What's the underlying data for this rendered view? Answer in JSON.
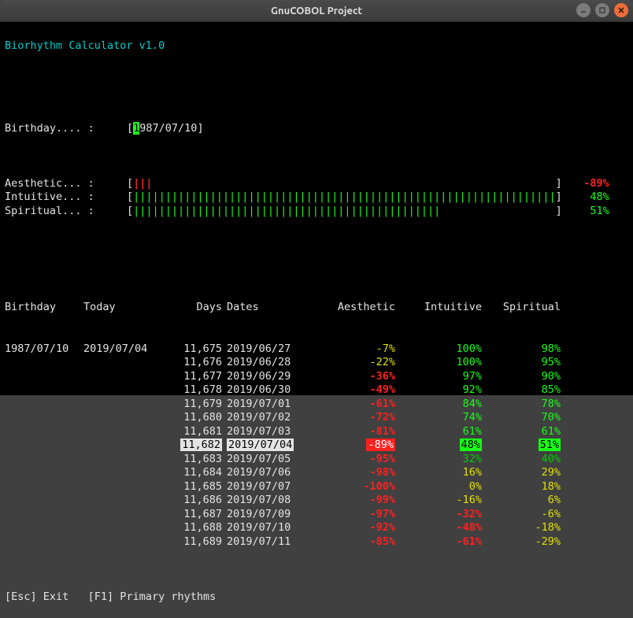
{
  "window": {
    "title": "GnuCOBOL Project"
  },
  "app_title": "Biorhythm Calculator v1.0",
  "input": {
    "label": "Birthday.... : ",
    "open": "[",
    "cursor_char": "1",
    "rest": "987/07/10",
    "close": "]",
    "full_value": "1987/07/10"
  },
  "bars": [
    {
      "label": "Aesthetic... : ",
      "color": "bred",
      "filled": 3,
      "total": 66,
      "pct": "-89%",
      "pct_color": "bred"
    },
    {
      "label": "Intuitive... : ",
      "color": "bgreen",
      "filled": 66,
      "total": 66,
      "pct": "48%",
      "pct_color": "bgreen"
    },
    {
      "label": "Spiritual... : ",
      "color": "bgreen",
      "filled": 48,
      "total": 66,
      "pct": "51%",
      "pct_color": "bgreen"
    }
  ],
  "headers": {
    "birthday": "Birthday",
    "today": "Today",
    "days": "Days",
    "dates": "Dates",
    "aesthetic": "Aesthetic",
    "intuitive": "Intuitive",
    "spiritual": "Spiritual"
  },
  "fixed": {
    "birthday": "1987/07/10",
    "today": "2019/07/04"
  },
  "rows": [
    {
      "days": "11,675",
      "date": "2019/06/27",
      "a": {
        "v": "-7%",
        "c": "yellow"
      },
      "i": {
        "v": "100%",
        "c": "bgreen"
      },
      "s": {
        "v": "98%",
        "c": "bgreen"
      },
      "hl": false
    },
    {
      "days": "11,676",
      "date": "2019/06/28",
      "a": {
        "v": "-22%",
        "c": "yellow"
      },
      "i": {
        "v": "100%",
        "c": "bgreen"
      },
      "s": {
        "v": "95%",
        "c": "bgreen"
      },
      "hl": false
    },
    {
      "days": "11,677",
      "date": "2019/06/29",
      "a": {
        "v": "-36%",
        "c": "bred"
      },
      "i": {
        "v": "97%",
        "c": "bgreen"
      },
      "s": {
        "v": "90%",
        "c": "bgreen"
      },
      "hl": false
    },
    {
      "days": "11,678",
      "date": "2019/06/30",
      "a": {
        "v": "-49%",
        "c": "bred"
      },
      "i": {
        "v": "92%",
        "c": "bgreen"
      },
      "s": {
        "v": "85%",
        "c": "bgreen"
      },
      "hl": false
    },
    {
      "days": "11,679",
      "date": "2019/07/01",
      "a": {
        "v": "-61%",
        "c": "bred"
      },
      "i": {
        "v": "84%",
        "c": "bgreen"
      },
      "s": {
        "v": "78%",
        "c": "bgreen"
      },
      "hl": false
    },
    {
      "days": "11,680",
      "date": "2019/07/02",
      "a": {
        "v": "-72%",
        "c": "bred"
      },
      "i": {
        "v": "74%",
        "c": "bgreen"
      },
      "s": {
        "v": "70%",
        "c": "bgreen"
      },
      "hl": false
    },
    {
      "days": "11,681",
      "date": "2019/07/03",
      "a": {
        "v": "-81%",
        "c": "bred"
      },
      "i": {
        "v": "61%",
        "c": "bgreen"
      },
      "s": {
        "v": "61%",
        "c": "bgreen"
      },
      "hl": false
    },
    {
      "days": "11,682",
      "date": "2019/07/04",
      "a": {
        "v": "-89%",
        "c": "invR"
      },
      "i": {
        "v": "48%",
        "c": "invG"
      },
      "s": {
        "v": "51%",
        "c": "invG"
      },
      "hl": true
    },
    {
      "days": "11,683",
      "date": "2019/07/05",
      "a": {
        "v": "-95%",
        "c": "bred"
      },
      "i": {
        "v": "32%",
        "c": "green"
      },
      "s": {
        "v": "40%",
        "c": "green"
      },
      "hl": false
    },
    {
      "days": "11,684",
      "date": "2019/07/06",
      "a": {
        "v": "-98%",
        "c": "bred"
      },
      "i": {
        "v": "16%",
        "c": "yellow"
      },
      "s": {
        "v": "29%",
        "c": "yellow"
      },
      "hl": false
    },
    {
      "days": "11,685",
      "date": "2019/07/07",
      "a": {
        "v": "-100%",
        "c": "bred"
      },
      "i": {
        "v": "0%",
        "c": "yellow"
      },
      "s": {
        "v": "18%",
        "c": "yellow"
      },
      "hl": false
    },
    {
      "days": "11,686",
      "date": "2019/07/08",
      "a": {
        "v": "-99%",
        "c": "bred"
      },
      "i": {
        "v": "-16%",
        "c": "yellow"
      },
      "s": {
        "v": "6%",
        "c": "yellow"
      },
      "hl": false
    },
    {
      "days": "11,687",
      "date": "2019/07/09",
      "a": {
        "v": "-97%",
        "c": "bred"
      },
      "i": {
        "v": "-32%",
        "c": "bred"
      },
      "s": {
        "v": "-6%",
        "c": "yellow"
      },
      "hl": false
    },
    {
      "days": "11,688",
      "date": "2019/07/10",
      "a": {
        "v": "-92%",
        "c": "bred"
      },
      "i": {
        "v": "-48%",
        "c": "bred"
      },
      "s": {
        "v": "-18%",
        "c": "yellow"
      },
      "hl": false
    },
    {
      "days": "11,689",
      "date": "2019/07/11",
      "a": {
        "v": "-85%",
        "c": "bred"
      },
      "i": {
        "v": "-61%",
        "c": "bred"
      },
      "s": {
        "v": "-29%",
        "c": "yellow"
      },
      "hl": false
    }
  ],
  "footer": {
    "esc": "[Esc] Exit",
    "sep": "   ",
    "f1": "[F1] Primary rhythms"
  }
}
